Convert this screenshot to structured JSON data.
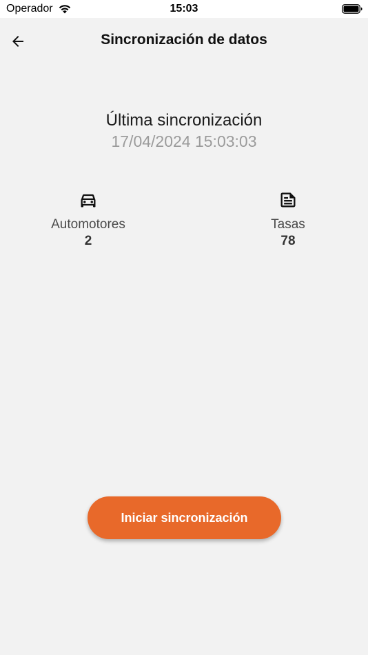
{
  "status_bar": {
    "carrier": "Operador",
    "time": "15:03"
  },
  "header": {
    "title": "Sincronización de datos",
    "back_icon": "arrow-left-icon"
  },
  "last_sync": {
    "label": "Última sincronización",
    "value": "17/04/2024 15:03:03"
  },
  "stats": [
    {
      "icon": "car-icon",
      "label": "Automotores",
      "value": "2"
    },
    {
      "icon": "document-icon",
      "label": "Tasas",
      "value": "78"
    }
  ],
  "actions": {
    "sync_button_label": "Iniciar sincronización"
  },
  "colors": {
    "accent": "#e8692a",
    "background": "#f2f2f2",
    "muted_text": "#9b9b9b"
  }
}
